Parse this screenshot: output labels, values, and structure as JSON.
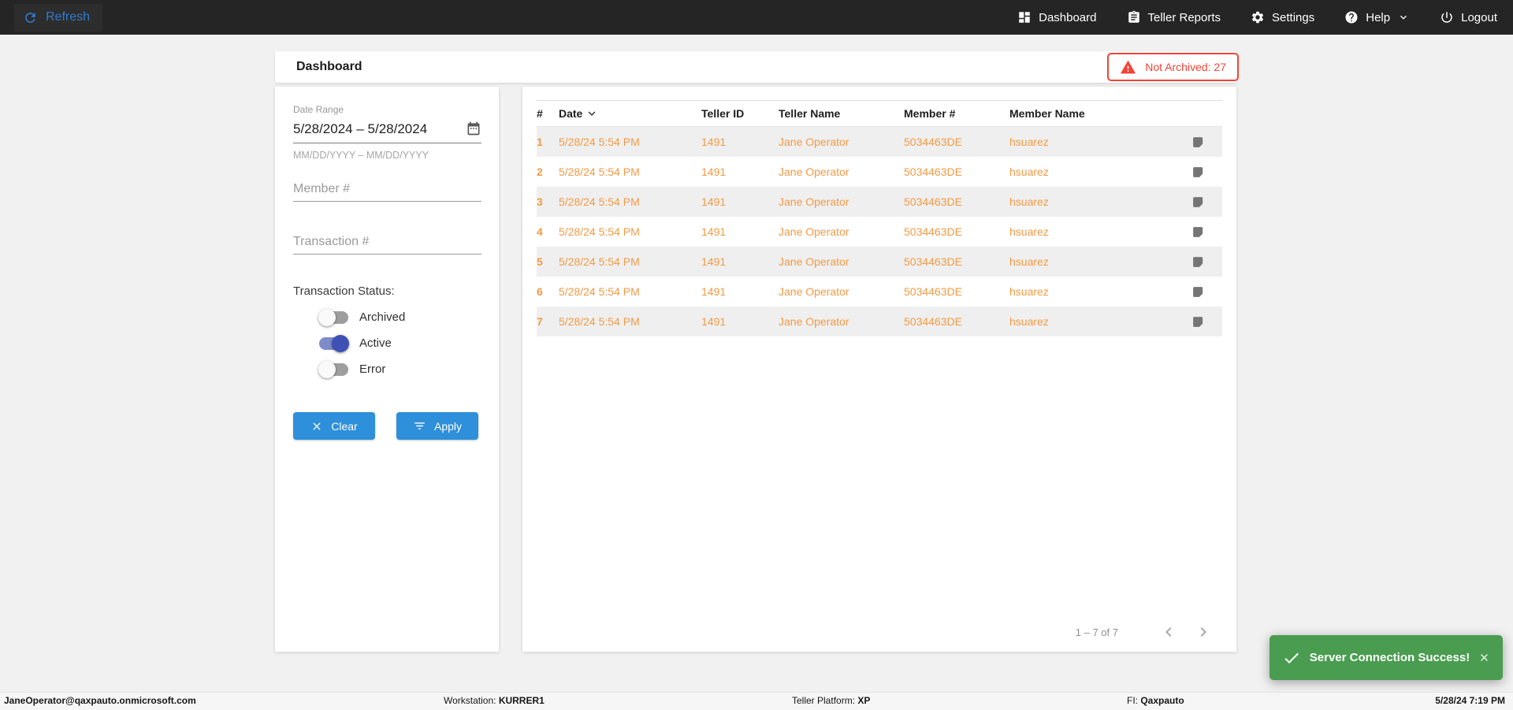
{
  "navbar": {
    "refresh_label": "Refresh",
    "items": [
      {
        "label": "Dashboard",
        "icon": "dashboard-icon"
      },
      {
        "label": "Teller Reports",
        "icon": "clipboard-icon"
      },
      {
        "label": "Settings",
        "icon": "gear-icon"
      },
      {
        "label": "Help",
        "icon": "help-icon"
      },
      {
        "label": "Logout",
        "icon": "power-icon"
      }
    ]
  },
  "header": {
    "title": "Dashboard",
    "badge_label": "Not Archived: 27"
  },
  "filters": {
    "date_range": {
      "label": "Date Range",
      "value": "5/28/2024 – 5/28/2024",
      "helper": "MM/DD/YYYY – MM/DD/YYYY"
    },
    "member_placeholder": "Member #",
    "transaction_placeholder": "Transaction #",
    "status_label": "Transaction Status:",
    "toggles": [
      {
        "label": "Archived",
        "on": false
      },
      {
        "label": "Active",
        "on": true
      },
      {
        "label": "Error",
        "on": false
      }
    ],
    "clear_label": "Clear",
    "apply_label": "Apply"
  },
  "table": {
    "columns": [
      "#",
      "Date",
      "Teller ID",
      "Teller Name",
      "Member #",
      "Member Name"
    ],
    "rows": [
      {
        "num": "1",
        "date": "5/28/24 5:54 PM",
        "teller_id": "1491",
        "teller_name": "Jane Operator",
        "member_num": "5034463DE",
        "member_name": "hsuarez"
      },
      {
        "num": "2",
        "date": "5/28/24 5:54 PM",
        "teller_id": "1491",
        "teller_name": "Jane Operator",
        "member_num": "5034463DE",
        "member_name": "hsuarez"
      },
      {
        "num": "3",
        "date": "5/28/24 5:54 PM",
        "teller_id": "1491",
        "teller_name": "Jane Operator",
        "member_num": "5034463DE",
        "member_name": "hsuarez"
      },
      {
        "num": "4",
        "date": "5/28/24 5:54 PM",
        "teller_id": "1491",
        "teller_name": "Jane Operator",
        "member_num": "5034463DE",
        "member_name": "hsuarez"
      },
      {
        "num": "5",
        "date": "5/28/24 5:54 PM",
        "teller_id": "1491",
        "teller_name": "Jane Operator",
        "member_num": "5034463DE",
        "member_name": "hsuarez"
      },
      {
        "num": "6",
        "date": "5/28/24 5:54 PM",
        "teller_id": "1491",
        "teller_name": "Jane Operator",
        "member_num": "5034463DE",
        "member_name": "hsuarez"
      },
      {
        "num": "7",
        "date": "5/28/24 5:54 PM",
        "teller_id": "1491",
        "teller_name": "Jane Operator",
        "member_num": "5034463DE",
        "member_name": "hsuarez"
      }
    ],
    "pagination_range": "1 – 7 of 7"
  },
  "toast": {
    "message": "Server Connection Success!"
  },
  "footer": {
    "email": "JaneOperator@qaxpauto.onmicrosoft.com",
    "workstation_label": "Workstation: ",
    "workstation_value": "KURRER1",
    "platform_label": "Teller Platform: ",
    "platform_value": "XP",
    "fi_label": "FI: ",
    "fi_value": "Qaxpauto",
    "datetime": "5/28/24 7:19 PM"
  },
  "colors": {
    "navbar_bg": "#252525",
    "accent_blue": "#2e8fdb",
    "refresh_blue": "#2e7bd3",
    "row_orange": "#f39a43",
    "error_red": "#f44336",
    "success_green": "#4a9d50",
    "toggle_on_indigo": "#3f51b5"
  }
}
